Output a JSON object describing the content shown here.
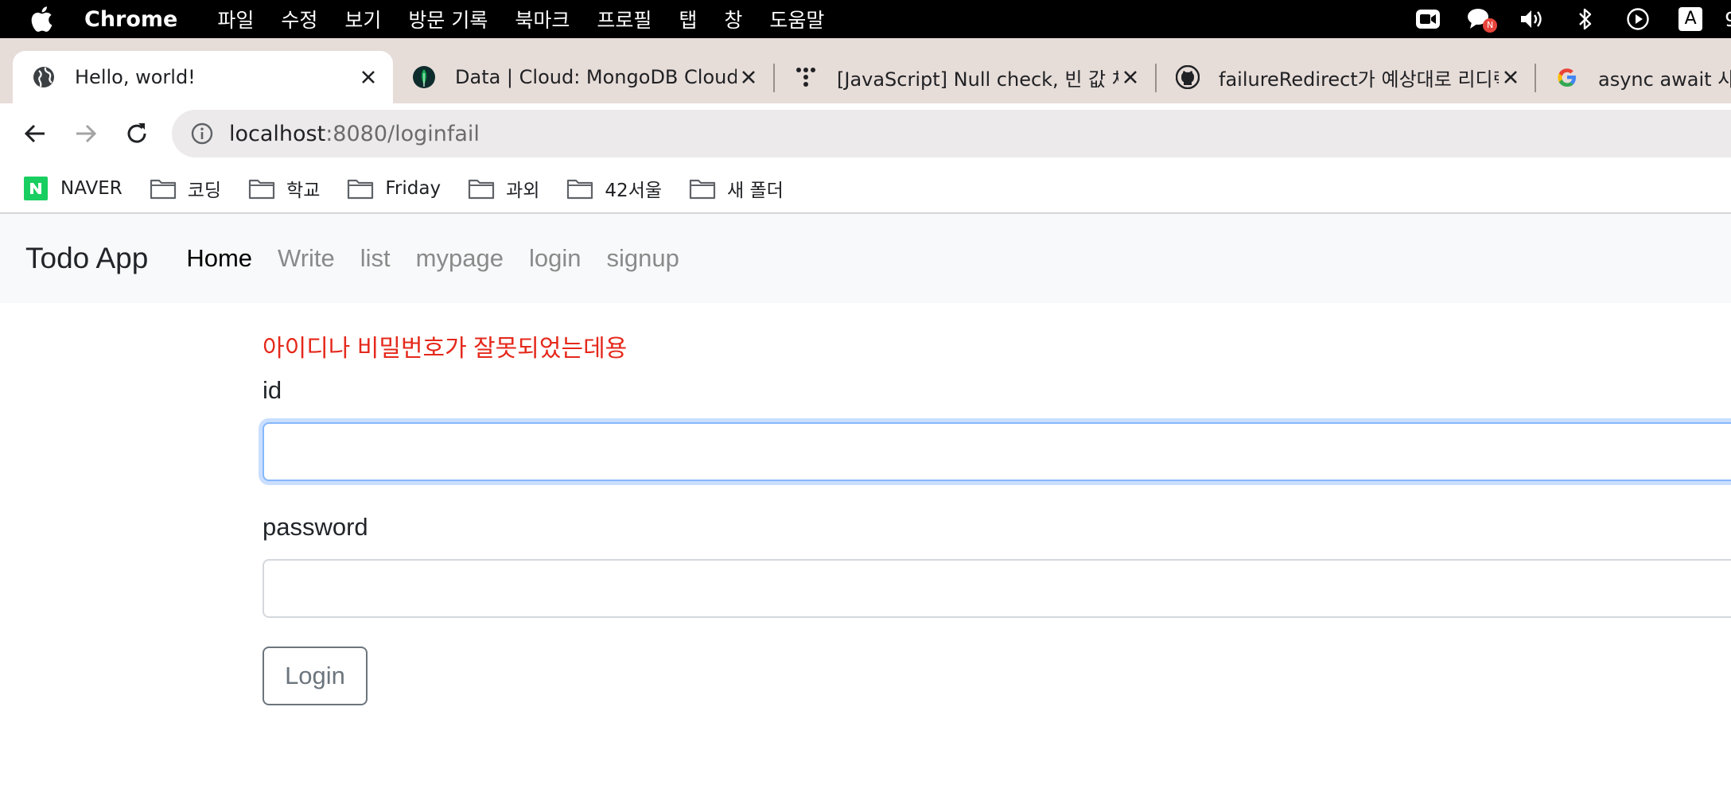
{
  "menubar": {
    "app_name": "Chrome",
    "items": [
      "파일",
      "수정",
      "보기",
      "방문 기록",
      "북마크",
      "프로필",
      "탭",
      "창",
      "도움말"
    ],
    "status_icons": [
      "zoom-icon",
      "chat-notification-icon",
      "volume-icon",
      "bluetooth-icon",
      "play-icon",
      "input-source-icon"
    ],
    "input_source_letter": "A",
    "chat_badge": "N",
    "clock_fragment": "9"
  },
  "tabs": [
    {
      "title": "Hello, world!",
      "icon": "globe-icon",
      "active": true
    },
    {
      "title": "Data | Cloud: MongoDB Cloud",
      "icon": "mongodb-leaf-icon",
      "active": false
    },
    {
      "title": "[JavaScript] Null check, 빈 값 체",
      "icon": "dots-logo-icon",
      "active": false
    },
    {
      "title": "failureRedirect가 예상대로 리디렉",
      "icon": "github-icon",
      "active": false
    },
    {
      "title": "async await 사용",
      "icon": "google-icon",
      "active": false
    }
  ],
  "omnibox": {
    "host": "localhost",
    "path": ":8080/loginfail"
  },
  "bookmarks": [
    {
      "label": "NAVER",
      "icon": "naver-icon"
    },
    {
      "label": "코딩",
      "icon": "folder-icon"
    },
    {
      "label": "학교",
      "icon": "folder-icon"
    },
    {
      "label": "Friday",
      "icon": "folder-icon"
    },
    {
      "label": "과외",
      "icon": "folder-icon"
    },
    {
      "label": "42서울",
      "icon": "folder-icon"
    },
    {
      "label": "새 폴더",
      "icon": "folder-icon"
    }
  ],
  "navbar": {
    "brand": "Todo App",
    "links": [
      "Home",
      "Write",
      "list",
      "mypage",
      "login",
      "signup"
    ],
    "active_link": "Home"
  },
  "form": {
    "error_message": "아이디나 비밀번호가 잘못되었는데용",
    "id_label": "id",
    "id_value": "",
    "password_label": "password",
    "password_value": "",
    "submit_label": "Login"
  },
  "colors": {
    "error": "#e5281b",
    "focus_ring": "#86b7fe",
    "tabstrip": "#e6dcd8",
    "navbar_bg": "#f8f9fa"
  }
}
